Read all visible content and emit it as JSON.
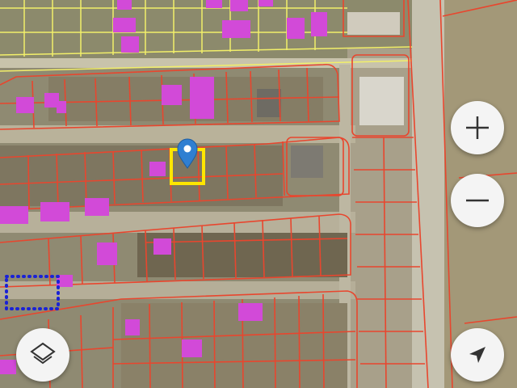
{
  "map": {
    "type": "satellite-cadastral",
    "colors": {
      "parcel_line": "#e8462e",
      "old_parcel_line": "#f2ef6a",
      "building": "#d24ad8",
      "selected_parcel": "#ffe600",
      "pin": "#2f7fd1",
      "dotted_boundary": "#1a22d6",
      "road": "#c9c4b2",
      "field": "#9a8f70"
    },
    "selected_parcel": {
      "outline": "yellow-square",
      "marker": "map-pin-icon"
    }
  },
  "controls": {
    "zoom_in": {
      "icon": "plus-icon"
    },
    "zoom_out": {
      "icon": "minus-icon"
    },
    "layers": {
      "icon": "layers-icon"
    },
    "locate": {
      "icon": "navigation-arrow-icon"
    }
  }
}
